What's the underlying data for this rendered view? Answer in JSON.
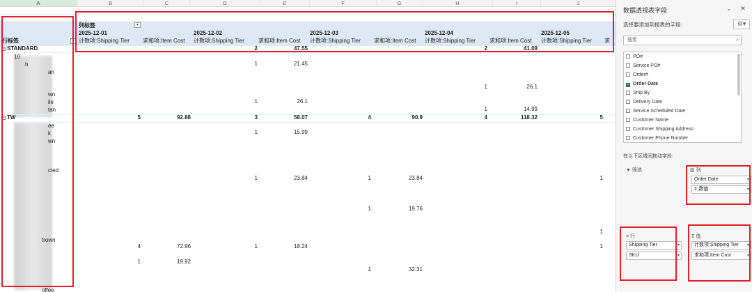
{
  "sheet": {
    "columns": [
      "A",
      "B",
      "C",
      "D",
      "E",
      "F",
      "G",
      "H",
      "I",
      "J"
    ],
    "col_label_header": "列标签",
    "row_label_header": "行标签",
    "dates": [
      "2025-12-01",
      "2025-12-02",
      "2025-12-03",
      "2025-12-04",
      "2025-12-05"
    ],
    "measure_ship": "计数项:Shipping Tier",
    "measure_cost": "求和项:Item Cost",
    "groups": {
      "standard": {
        "label": "STANDARD",
        "d2_count": "2",
        "d2_cost": "47.55",
        "d4_count": "2",
        "d4_cost": "41.09"
      },
      "tw": {
        "label": "TW",
        "d1_count": "5",
        "d1_cost": "92.88",
        "d2_count": "3",
        "d2_cost": "58.07",
        "d3_count": "4",
        "d3_cost": "90.9",
        "d4_count": "4",
        "d4_cost": "118.32",
        "d5_count": "5"
      }
    },
    "visible_sku_fragments": [
      "10",
      "h",
      "an",
      "wn",
      "ile",
      "tan",
      "TW",
      "ee",
      "k",
      "wn",
      "e",
      "cted",
      "d",
      "n",
      "n",
      "trown",
      "ee",
      "ee",
      "e",
      "offee"
    ],
    "rows": [
      {
        "d2c": "1",
        "d2v": "21.45"
      },
      {
        "d4c": "1",
        "d4v": "26.1"
      },
      {
        "d2c": "1",
        "d2v": "26.1"
      },
      {
        "d4c": "1",
        "d4v": "14.99"
      },
      {
        "d2c": "1",
        "d2v": "15.99"
      },
      {
        "d2c": "1",
        "d2v": "23.84",
        "d3c": "1",
        "d3v": "23.84",
        "d5c": "1"
      },
      {
        "d3c": "1",
        "d3v": "19.76"
      },
      {
        "d5c": "1"
      },
      {
        "d1c": "4",
        "d1v": "72.96",
        "d2c": "1",
        "d2v": "18.24",
        "d5c": "1"
      },
      {
        "d1c": "1",
        "d1v": "19.92"
      },
      {
        "d3c": "1",
        "d3v": "32.31"
      }
    ]
  },
  "pane": {
    "title": "数据透视表字段",
    "subtitle": "选择要添加到报表的字段:",
    "search_placeholder": "搜索",
    "fields": [
      {
        "label": "PO#",
        "checked": false
      },
      {
        "label": "Service PO#",
        "checked": false
      },
      {
        "label": "Order#",
        "checked": false
      },
      {
        "label": "Order Date",
        "checked": true
      },
      {
        "label": "Ship By",
        "checked": false
      },
      {
        "label": "Delivery Date",
        "checked": false
      },
      {
        "label": "Service Scheduled Date",
        "checked": false
      },
      {
        "label": "Customer Name",
        "checked": false
      },
      {
        "label": "Customer Shipping Address",
        "checked": false
      },
      {
        "label": "Customer Phone Number",
        "checked": false
      }
    ],
    "drag_hint": "在以下区域间拖动字段:",
    "filter_label": "筛选",
    "columns_label": "列",
    "rows_label": "行",
    "values_label": "值",
    "columns_items": [
      "Order Date",
      "Σ 数值"
    ],
    "rows_items": [
      "Shipping Tier",
      "SKU"
    ],
    "values_items": [
      "计数项:Shipping Tier",
      "求和项:Item Cost"
    ],
    "icons": {
      "close": "close-icon",
      "chevron": "chevron-down-icon",
      "gear": "gear-icon"
    },
    "accent_color": "#217346",
    "highlight_color": "#e0202a"
  }
}
